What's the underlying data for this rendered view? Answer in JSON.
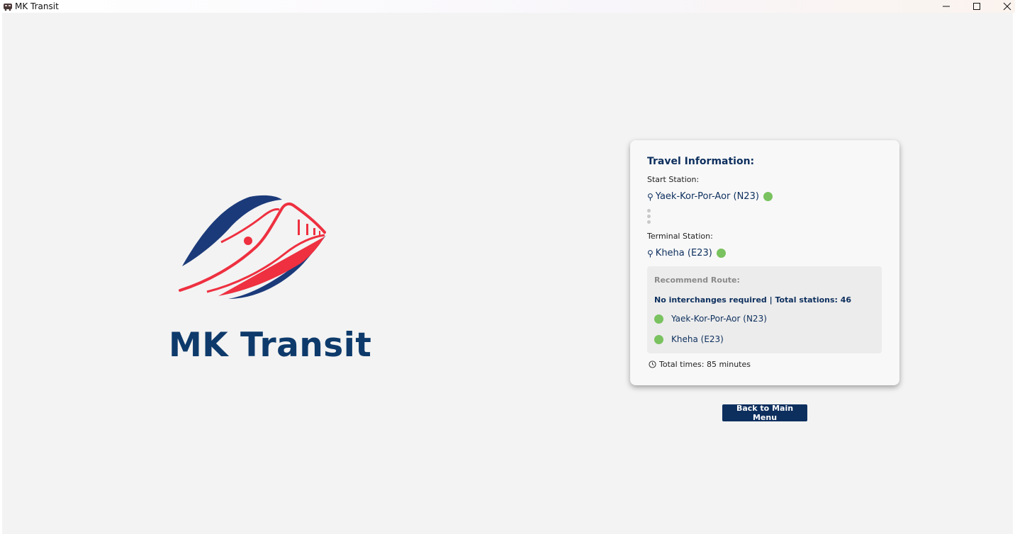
{
  "window": {
    "title": "MK Transit",
    "controls": [
      "minimize",
      "maximize",
      "close"
    ]
  },
  "brand": {
    "name": "MK Transit",
    "colors": {
      "navy": "#0e3a6b",
      "red": "#ee3040"
    }
  },
  "travel_card": {
    "title": "Travel Information:",
    "start_label": "Start Station:",
    "start_station": "Yaek-Kor-Por-Aor (N23)",
    "terminal_label": "Terminal Station:",
    "terminal_station": "Kheha (E23)",
    "line_color": "#79c25f",
    "route": {
      "title": "Recommend Route:",
      "summary": "No interchanges required | Total stations: 46",
      "stops": [
        "Yaek-Kor-Por-Aor (N23)",
        "Kheha (E23)"
      ]
    },
    "total_time": "Total times: 85 minutes"
  },
  "back_button": {
    "label": "Back to Main Menu"
  }
}
